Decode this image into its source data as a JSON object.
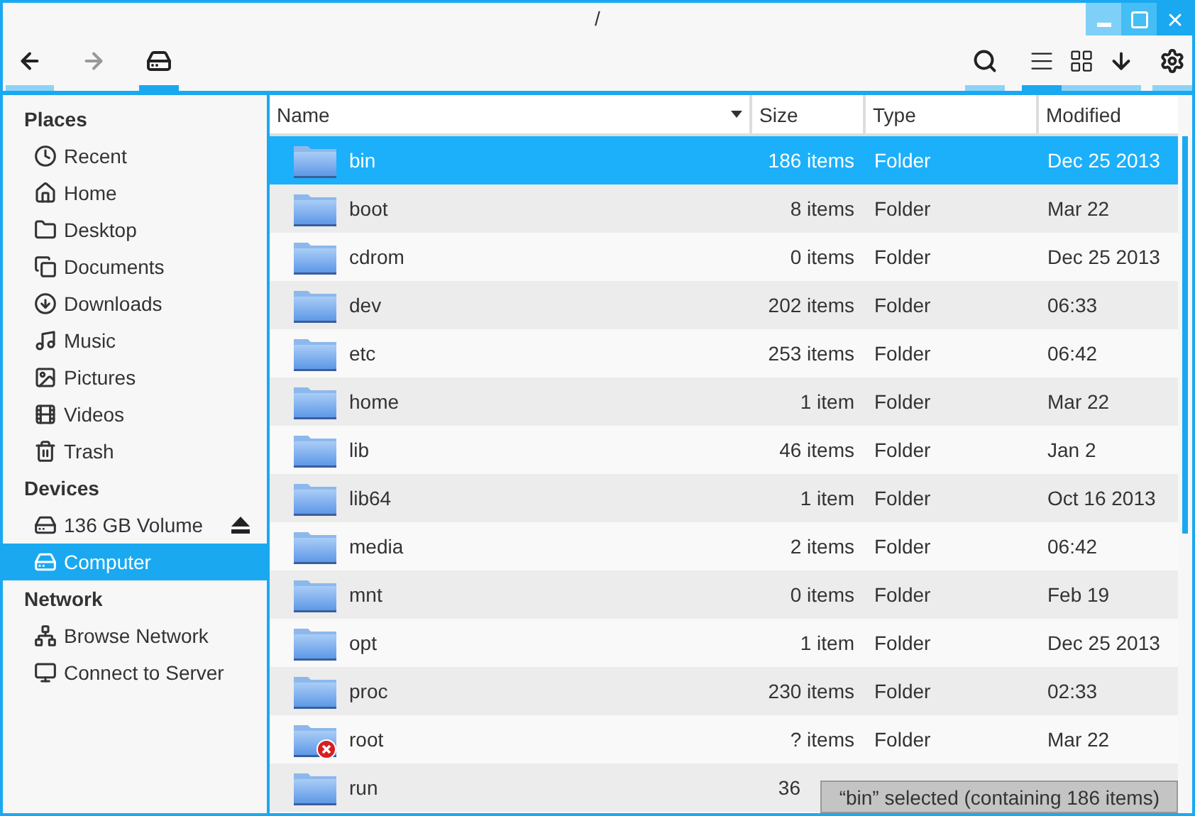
{
  "window": {
    "title": "/",
    "controls": [
      {
        "kind": "minimize"
      },
      {
        "kind": "maximize"
      },
      {
        "kind": "close"
      }
    ]
  },
  "toolbar": {
    "left": [
      {
        "kind": "back",
        "disabled": false,
        "selected": false
      },
      {
        "kind": "forward",
        "disabled": true,
        "selected": false
      },
      {
        "kind": "drive",
        "disabled": false,
        "selected": true
      }
    ],
    "right": [
      {
        "kind": "search",
        "disabled": false,
        "selected": false
      },
      {
        "kind": "list",
        "disabled": false,
        "selected": true
      },
      {
        "kind": "grid",
        "disabled": false,
        "selected": false
      },
      {
        "kind": "download",
        "disabled": false,
        "selected": false
      },
      {
        "kind": "settings",
        "disabled": false,
        "selected": false
      }
    ]
  },
  "sidebar": {
    "sections": [
      {
        "title": "Places",
        "items": [
          {
            "label": "Recent",
            "kind": "recent",
            "selected": false,
            "ejectable": false
          },
          {
            "label": "Home",
            "kind": "home",
            "selected": false,
            "ejectable": false
          },
          {
            "label": "Desktop",
            "kind": "desktop",
            "selected": false,
            "ejectable": false
          },
          {
            "label": "Documents",
            "kind": "documents",
            "selected": false,
            "ejectable": false
          },
          {
            "label": "Downloads",
            "kind": "downloads",
            "selected": false,
            "ejectable": false
          },
          {
            "label": "Music",
            "kind": "music",
            "selected": false,
            "ejectable": false
          },
          {
            "label": "Pictures",
            "kind": "pictures",
            "selected": false,
            "ejectable": false
          },
          {
            "label": "Videos",
            "kind": "videos",
            "selected": false,
            "ejectable": false
          },
          {
            "label": "Trash",
            "kind": "trash",
            "selected": false,
            "ejectable": false
          }
        ]
      },
      {
        "title": "Devices",
        "items": [
          {
            "label": "136 GB Volume",
            "kind": "drive",
            "selected": false,
            "ejectable": true
          },
          {
            "label": "Computer",
            "kind": "drive",
            "selected": true,
            "ejectable": false
          }
        ]
      },
      {
        "title": "Network",
        "items": [
          {
            "label": "Browse Network",
            "kind": "network",
            "selected": false,
            "ejectable": false
          },
          {
            "label": "Connect to Server",
            "kind": "server",
            "selected": false,
            "ejectable": false
          }
        ]
      }
    ]
  },
  "table": {
    "columns": [
      {
        "label": "Name",
        "sorted": true
      },
      {
        "label": "Size",
        "sorted": false
      },
      {
        "label": "Type",
        "sorted": false
      },
      {
        "label": "Modified",
        "sorted": false
      }
    ],
    "rows": [
      {
        "name": "bin",
        "size": "186 items",
        "type": "Folder",
        "modified": "Dec 25 2013",
        "selected": true,
        "locked": false
      },
      {
        "name": "boot",
        "size": "8 items",
        "type": "Folder",
        "modified": "Mar 22",
        "selected": false,
        "locked": false
      },
      {
        "name": "cdrom",
        "size": "0 items",
        "type": "Folder",
        "modified": "Dec 25 2013",
        "selected": false,
        "locked": false
      },
      {
        "name": "dev",
        "size": "202 items",
        "type": "Folder",
        "modified": "06:33",
        "selected": false,
        "locked": false
      },
      {
        "name": "etc",
        "size": "253 items",
        "type": "Folder",
        "modified": "06:42",
        "selected": false,
        "locked": false
      },
      {
        "name": "home",
        "size": "1 item",
        "type": "Folder",
        "modified": "Mar 22",
        "selected": false,
        "locked": false
      },
      {
        "name": "lib",
        "size": "46 items",
        "type": "Folder",
        "modified": "Jan 2",
        "selected": false,
        "locked": false
      },
      {
        "name": "lib64",
        "size": "1 item",
        "type": "Folder",
        "modified": "Oct 16 2013",
        "selected": false,
        "locked": false
      },
      {
        "name": "media",
        "size": "2 items",
        "type": "Folder",
        "modified": "06:42",
        "selected": false,
        "locked": false
      },
      {
        "name": "mnt",
        "size": "0 items",
        "type": "Folder",
        "modified": "Feb 19",
        "selected": false,
        "locked": false
      },
      {
        "name": "opt",
        "size": "1 item",
        "type": "Folder",
        "modified": "Dec 25 2013",
        "selected": false,
        "locked": false
      },
      {
        "name": "proc",
        "size": "230 items",
        "type": "Folder",
        "modified": "02:33",
        "selected": false,
        "locked": false
      },
      {
        "name": "root",
        "size": "? items",
        "type": "Folder",
        "modified": "Mar 22",
        "selected": false,
        "locked": true
      },
      {
        "name": "run",
        "size": "36",
        "selected": false,
        "locked": false
      }
    ]
  },
  "status_bar": {
    "text": "“bin” selected (containing 186 items)"
  }
}
